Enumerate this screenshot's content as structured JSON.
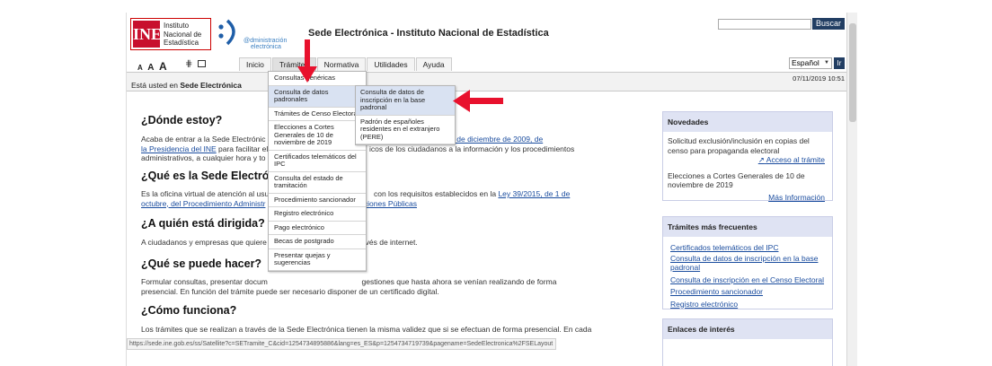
{
  "header": {
    "logo_abbr": "INE",
    "logo_line1": "Instituto",
    "logo_line2": "Nacional de",
    "logo_line3": "Estadística",
    "ae_line1": "@dministración",
    "ae_line2": "electrónica",
    "site_title": "Sede Electrónica - Instituto Nacional de Estadística",
    "search_button": "Buscar",
    "search_value": ""
  },
  "toolbar": {
    "font_small": "A",
    "font_medium": "A",
    "font_large": "A",
    "nav": [
      "Inicio",
      "Trámites",
      "Normativa",
      "Utilidades",
      "Ayuda"
    ],
    "language": "Español",
    "go_button": "Ir"
  },
  "breadcrumb": {
    "prefix": "Está usted en",
    "current": "Sede Electrónica",
    "date": "07/11/2019 10:51"
  },
  "content": {
    "h1": "¿Dónde estoy?",
    "p1a": "Acaba de entrar a la Sede Electrónic",
    "p1link": "Resolución de 16 de diciembre de 2009, de",
    "p1link2": "la Presidencia del INE",
    "p1b": "para facilitar el",
    "p1c": "icos de los ciudadanos a la información y los procedimientos",
    "p1d": "administrativos, a cualquier hora y to",
    "h2": "¿Qué es la Sede Electróni",
    "p2a": "Es la oficina virtual de atención al usu",
    "p2b": "con los requisitos establecidos en la",
    "p2link": "Ley 39/2015, de 1 de",
    "p2link2": "octubre, del Procedimiento Administr",
    "p2link3": "aciones Públicas",
    "h3": "¿A quién está dirigida?",
    "p3a": "A ciudadanos y empresas que quiere",
    "p3b": "vés de internet.",
    "h4": "¿Qué se puede hacer?",
    "p4a": "Formular consultas, presentar docum",
    "p4b": "gestiones que hasta ahora se venían realizando de forma",
    "p4c": "presencial. En función del trámite puede ser necesario disponer de un certificado digital.",
    "h5": "¿Cómo funciona?",
    "p5a": "Los trámites que se realizan a través de la Sede Electrónica tienen la misma validez que si se efectuan de forma presencial. En cada"
  },
  "menu": {
    "items": [
      "Consultas genéricas",
      "Consulta de datos padronales",
      "Trámites de Censo Electoral",
      "Elecciones a Cortes Generales de 10 de noviembre de 2019",
      "Certificados telemáticos del IPC",
      "Consulta del estado de tramitación",
      "Procedimiento sancionador",
      "Registro electrónico",
      "Pago electrónico",
      "Becas de postgrado",
      "Presentar quejas y sugerencias"
    ],
    "submenu": [
      "Consulta de datos de inscripción en la base padronal",
      "Padrón de españoles residentes en el extranjero (PERE)"
    ]
  },
  "sidebar": {
    "novedades_title": "Novedades",
    "nov1": "Solicitud exclusión/inclusión en copias del censo para propaganda electoral",
    "nov1_link": "Acceso al trámite",
    "nov2": "Elecciones a Cortes Generales de 10 de noviembre de 2019",
    "nov2_link": "Más Información",
    "frecuentes_title": "Trámites más frecuentes",
    "frecuentes": [
      "Certificados telemáticos del IPC",
      "Consulta de datos de inscripción en la base padronal",
      "Consulta de inscripción en el Censo Electoral",
      "Procedimiento sancionador",
      "Registro electrónico"
    ],
    "enlaces_title": "Enlaces de interés"
  },
  "status_url": "https://sede.ine.gob.es/ss/Satellite?c=SETramite_C&cid=1254734895886&lang=es_ES&p=1254734719739&pagename=SedeElectronica%2FSELayout",
  "colors": {
    "ine_red": "#c8102e",
    "link_blue": "#1a4c9e",
    "button_navy": "#223e63",
    "highlight": "#d9e2f2",
    "annotation_arrow": "#e8112d"
  }
}
